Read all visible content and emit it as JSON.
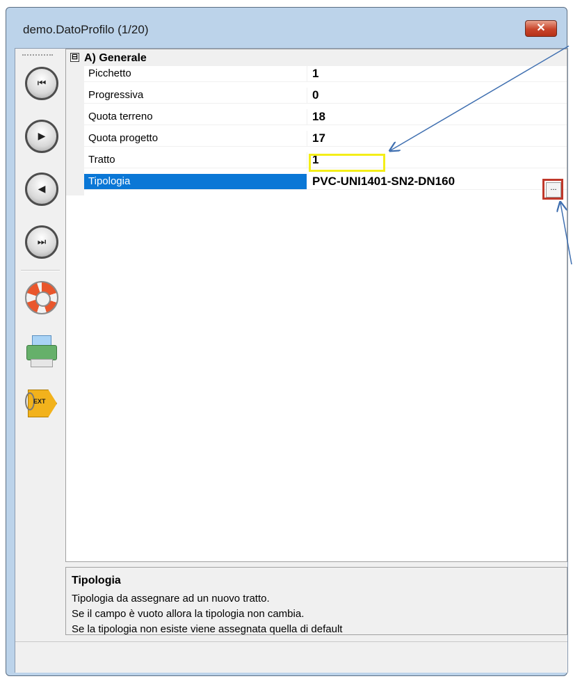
{
  "window": {
    "title": "demo.DatoProfilo (1/20)",
    "close_glyph": "✕"
  },
  "toolbar": {
    "buttons": [
      {
        "icon": "first-record-icon",
        "glyph": "⏮"
      },
      {
        "icon": "next-record-icon",
        "glyph": "▶"
      },
      {
        "icon": "previous-record-icon",
        "glyph": "◀"
      },
      {
        "icon": "last-record-icon",
        "glyph": "⏭"
      },
      {
        "icon": "help-lifebuoy-icon"
      },
      {
        "icon": "printer-icon"
      },
      {
        "icon": "ext-tag-icon",
        "label": "EXT"
      }
    ]
  },
  "grid": {
    "category": {
      "expander": "⊟",
      "label": "A) Generale"
    },
    "properties": [
      {
        "name": "Picchetto",
        "value": "1"
      },
      {
        "name": "Progressiva",
        "value": "0"
      },
      {
        "name": "Quota terreno",
        "value": "18"
      },
      {
        "name": "Quota progetto",
        "value": "17"
      },
      {
        "name": "Tratto",
        "value": "1"
      },
      {
        "name": "Tipologia",
        "value": "PVC-UNI1401-SN2-DN160",
        "selected": true,
        "has_ellipsis": true
      }
    ],
    "ellipsis_label": "..."
  },
  "help": {
    "title": "Tipologia",
    "lines": [
      "Tipologia da assegnare ad un nuovo tratto.",
      "Se il campo è vuoto allora la tipologia non cambia.",
      "Se la tipologia non esiste viene assegnata quella di default"
    ]
  },
  "colors": {
    "selection": "#0a77d6",
    "highlight_yellow": "#f4ee18",
    "highlight_red": "#c0392b",
    "annotation_arrow": "#3f6fb0"
  }
}
